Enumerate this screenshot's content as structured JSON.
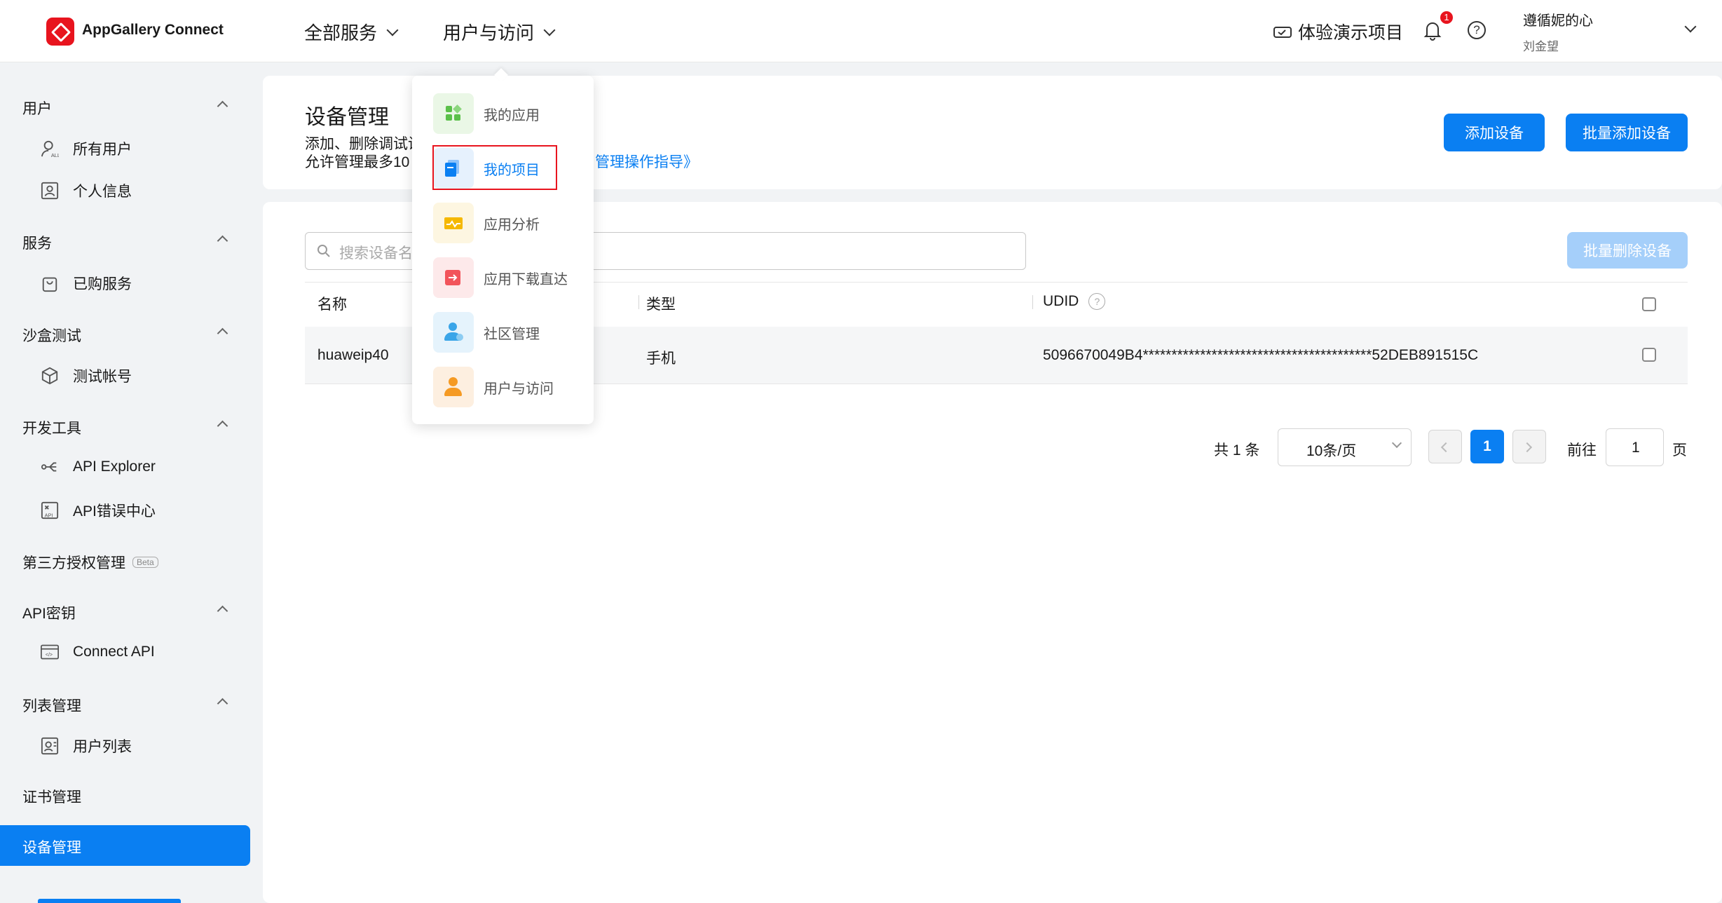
{
  "header": {
    "logo_text": "AppGallery Connect",
    "nav": [
      "全部服务",
      "用户与访问"
    ],
    "demo_project": "体验演示项目",
    "notification_count": "1",
    "user_name": "遵循妮的心",
    "user_sub": "刘金望"
  },
  "sidebar": {
    "sections": [
      {
        "label": "用户",
        "items": [
          "所有用户",
          "个人信息"
        ]
      },
      {
        "label": "服务",
        "items": [
          "已购服务"
        ]
      },
      {
        "label": "沙盒测试",
        "items": [
          "测试帐号"
        ]
      },
      {
        "label": "开发工具",
        "items": [
          "API Explorer",
          "API错误中心"
        ]
      },
      {
        "label": "第三方授权管理",
        "badge": "Beta",
        "items": []
      },
      {
        "label": "API密钥",
        "items": [
          "Connect API"
        ]
      },
      {
        "label": "列表管理",
        "items": [
          "用户列表"
        ]
      },
      {
        "label": "证书管理",
        "items": []
      },
      {
        "label": "设备管理",
        "items": [],
        "active": true
      }
    ]
  },
  "page": {
    "title": "设备管理",
    "desc_line1": "添加、删除调试设",
    "desc_line2": "允许管理最多10",
    "guide_link": "管理操作指导》",
    "add_button": "添加设备",
    "batch_add_button": "批量添加设备",
    "search_placeholder": "搜索设备名",
    "batch_delete_button": "批量删除设备"
  },
  "table": {
    "headers": [
      "名称",
      "类型",
      "UDID"
    ],
    "rows": [
      {
        "name": "huaweip40",
        "type": "手机",
        "udid": "5096670049B4****************************************52DEB891515C"
      }
    ]
  },
  "pagination": {
    "total": "共 1 条",
    "page_size": "10条/页",
    "current_page": "1",
    "goto_label": "前往",
    "goto_value": "1",
    "page_suffix": "页"
  },
  "dropdown": {
    "items": [
      {
        "label": "我的应用",
        "icon": "apps-icon",
        "color": "#5bc04a",
        "bg": "#eaf7e6"
      },
      {
        "label": "我的项目",
        "icon": "project-icon",
        "color": "#0a7ff2",
        "bg": "#e6f1fd",
        "selected": true
      },
      {
        "label": "应用分析",
        "icon": "analytics-icon",
        "color": "#f5b800",
        "bg": "#fdf6e1"
      },
      {
        "label": "应用下载直达",
        "icon": "download-direct-icon",
        "color": "#f2545b",
        "bg": "#fde9ea"
      },
      {
        "label": "社区管理",
        "icon": "community-icon",
        "color": "#3aa5e8",
        "bg": "#e5f3fc"
      },
      {
        "label": "用户与访问",
        "icon": "user-access-icon",
        "color": "#f59a23",
        "bg": "#fdefe0"
      }
    ]
  },
  "colors": {
    "accent": "#0a7ff2",
    "highlight_border": "#e8141e"
  }
}
